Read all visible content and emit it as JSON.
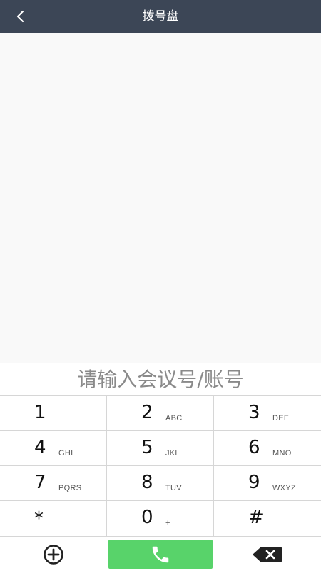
{
  "header": {
    "title": "拨号盘",
    "back_icon": "chevron-left-icon"
  },
  "input": {
    "placeholder": "请输入会议号/账号",
    "value": ""
  },
  "keypad": [
    {
      "digit": "1",
      "letters": ""
    },
    {
      "digit": "2",
      "letters": "ABC"
    },
    {
      "digit": "3",
      "letters": "DEF"
    },
    {
      "digit": "4",
      "letters": "GHI"
    },
    {
      "digit": "5",
      "letters": "JKL"
    },
    {
      "digit": "6",
      "letters": "MNO"
    },
    {
      "digit": "7",
      "letters": "PQRS"
    },
    {
      "digit": "8",
      "letters": "TUV"
    },
    {
      "digit": "9",
      "letters": "WXYZ"
    },
    {
      "digit": "*",
      "letters": ""
    },
    {
      "digit": "0",
      "letters": "+"
    },
    {
      "digit": "#",
      "letters": ""
    }
  ],
  "actions": {
    "add_icon": "plus-circle-icon",
    "call_icon": "phone-icon",
    "delete_icon": "backspace-icon"
  },
  "colors": {
    "header_bg": "#3c4656",
    "call_green": "#58d36a",
    "divider": "#d6d6d6"
  }
}
